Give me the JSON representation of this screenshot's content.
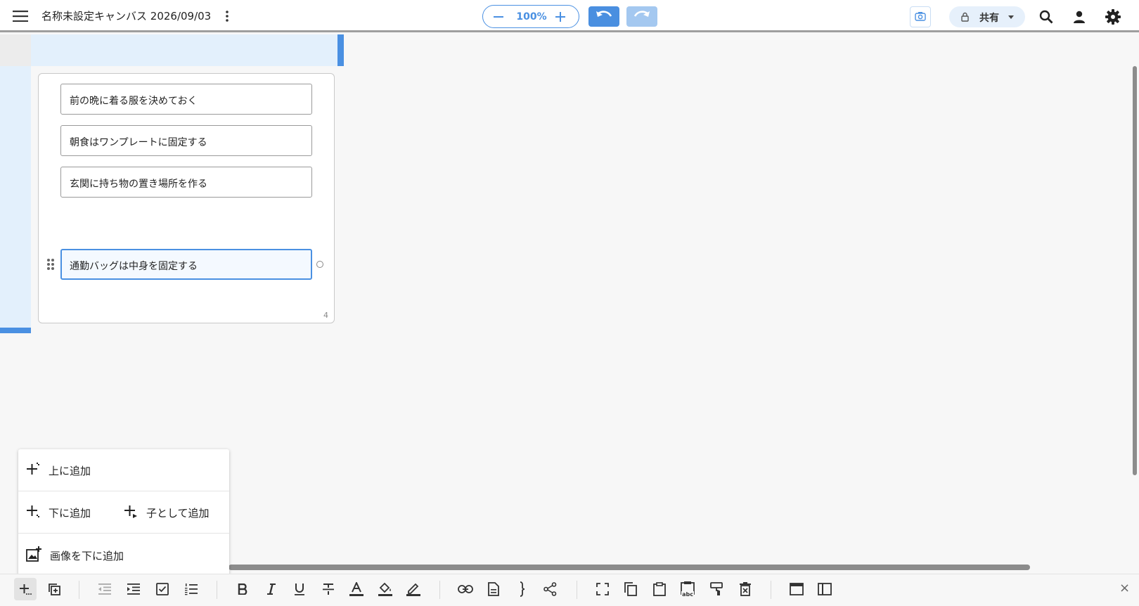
{
  "header": {
    "title": "名称未設定キャンバス 2026/09/03",
    "zoom": "100%",
    "share_label": "共有",
    "icons": [
      "menu-icon",
      "more-vert-icon",
      "zoom-out-icon",
      "zoom-in-icon",
      "undo-icon",
      "redo-icon",
      "camera-icon",
      "lock-icon",
      "dropdown-icon",
      "search-icon",
      "user-icon",
      "gear-icon"
    ]
  },
  "card": {
    "items": [
      "前の晩に着る服を決めておく",
      "朝食はワンプレートに固定する",
      "玄関に持ち物の置き場所を作る",
      "通勤バッグは中身を固定する"
    ],
    "active_index": 3,
    "count": "4"
  },
  "menu": {
    "add_above": "上に追加",
    "add_below": "下に追加",
    "add_child": "子として追加",
    "add_image_below": "画像を下に追加"
  },
  "toolbar": {
    "icons": [
      "add-icon",
      "duplicate-icon",
      "outdent-icon",
      "indent-icon",
      "checkbox-icon",
      "numbered-list-icon",
      "bold-icon",
      "italic-icon",
      "underline-icon",
      "strikethrough-icon",
      "text-color-icon",
      "fill-color-icon",
      "border-color-icon",
      "link-icon",
      "note-icon",
      "brace-icon",
      "connector-icon",
      "fit-icon",
      "copy-icon",
      "paste-icon",
      "paste-text-icon",
      "format-painter-icon",
      "delete-icon",
      "window-icon",
      "sidebar-icon",
      "close-icon"
    ],
    "paste_text_badge": "abc",
    "close": "×"
  },
  "colors": {
    "accent": "#4a90e2",
    "selection": "#e3f0fc",
    "redo_disabled": "#a4c8f0"
  }
}
